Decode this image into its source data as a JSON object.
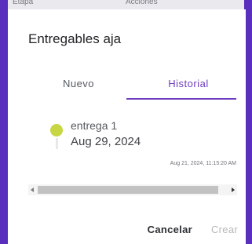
{
  "background": {
    "left_label": "Etapa",
    "right_label": "Acciones"
  },
  "dialog": {
    "title": "Entregables aja",
    "tabs": [
      {
        "label": "Nuevo",
        "active": false
      },
      {
        "label": "Historial",
        "active": true
      }
    ],
    "timeline": {
      "entries": [
        {
          "name": "entrega 1",
          "date": "Aug 29, 2024",
          "timestamp": "Aug 21, 2024, 11:15:20 AM",
          "dot_color": "#c7d744"
        }
      ]
    },
    "actions": {
      "cancel_label": "Cancelar",
      "create_label": "Crear"
    }
  },
  "colors": {
    "accent": "#6f3cc1",
    "backdrop": "#5b2fbe"
  }
}
